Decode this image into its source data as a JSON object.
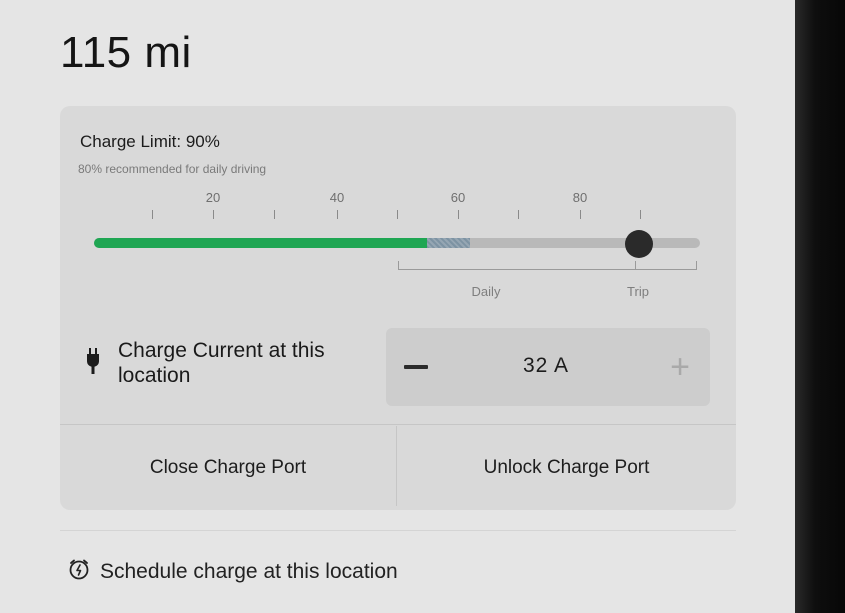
{
  "range": {
    "value": "115 mi"
  },
  "charge_limit": {
    "title": "Charge Limit: 90%",
    "subtitle": "80% recommended for daily driving",
    "percent": 90,
    "current_charge_percent": 55,
    "scheduled_extra_percent": 62,
    "scale_labels": [
      "20",
      "40",
      "60",
      "80"
    ],
    "zones": {
      "daily": "Daily",
      "trip": "Trip"
    },
    "colors": {
      "charged": "#1fa653",
      "charging": "#8a9fae",
      "knob": "#2a2a2a"
    }
  },
  "charge_current": {
    "label": "Charge Current at this location",
    "value": "32 A",
    "minus_icon": "minus-icon",
    "plus_icon": "plus-icon",
    "plug_icon": "plug-icon"
  },
  "actions": {
    "close_port": "Close Charge Port",
    "unlock_port": "Unlock Charge Port"
  },
  "schedule": {
    "label": "Schedule charge at this location",
    "icon": "alarm-clock-icon"
  }
}
